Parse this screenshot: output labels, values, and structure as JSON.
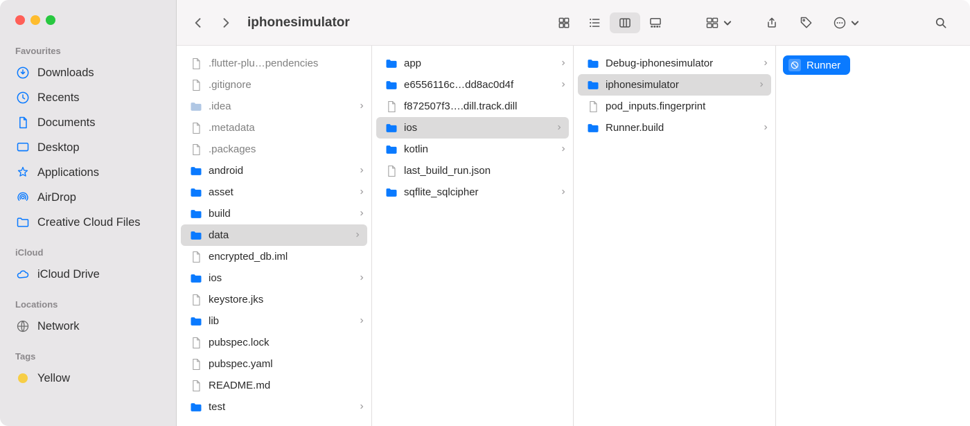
{
  "window_title": "iphonesimulator",
  "sidebar": {
    "favourites": {
      "heading": "Favourites",
      "items": [
        {
          "label": "Downloads",
          "icon": "download"
        },
        {
          "label": "Recents",
          "icon": "recents"
        },
        {
          "label": "Documents",
          "icon": "documents"
        },
        {
          "label": "Desktop",
          "icon": "desktop"
        },
        {
          "label": "Applications",
          "icon": "applications"
        },
        {
          "label": "AirDrop",
          "icon": "airdrop"
        },
        {
          "label": "Creative Cloud Files",
          "icon": "folder"
        }
      ]
    },
    "icloud": {
      "heading": "iCloud",
      "items": [
        {
          "label": "iCloud Drive",
          "icon": "cloud"
        }
      ]
    },
    "locations": {
      "heading": "Locations",
      "items": [
        {
          "label": "Network",
          "icon": "network"
        }
      ]
    },
    "tags": {
      "heading": "Tags",
      "items": [
        {
          "label": "Yellow",
          "color": "#f7ce46"
        }
      ]
    }
  },
  "columns": [
    {
      "selected_index": 8,
      "items": [
        {
          "label": ".flutter-plu…pendencies",
          "type": "file",
          "dim": true
        },
        {
          "label": ".gitignore",
          "type": "file",
          "dim": true
        },
        {
          "label": ".idea",
          "type": "folder",
          "dim": true,
          "expandable": true,
          "faded": true
        },
        {
          "label": ".metadata",
          "type": "file",
          "dim": true
        },
        {
          "label": ".packages",
          "type": "file",
          "dim": true
        },
        {
          "label": "android",
          "type": "folder",
          "expandable": true
        },
        {
          "label": "asset",
          "type": "folder",
          "expandable": true
        },
        {
          "label": "build",
          "type": "folder",
          "expandable": true
        },
        {
          "label": "data",
          "type": "folder",
          "expandable": true
        },
        {
          "label": "encrypted_db.iml",
          "type": "file",
          "icon": "iml"
        },
        {
          "label": "ios",
          "type": "folder",
          "expandable": true
        },
        {
          "label": "keystore.jks",
          "type": "file"
        },
        {
          "label": "lib",
          "type": "folder",
          "expandable": true
        },
        {
          "label": "pubspec.lock",
          "type": "file"
        },
        {
          "label": "pubspec.yaml",
          "type": "file",
          "icon": "yaml"
        },
        {
          "label": "README.md",
          "type": "file",
          "icon": "md"
        },
        {
          "label": "test",
          "type": "folder",
          "expandable": true
        }
      ]
    },
    {
      "selected_index": 3,
      "items": [
        {
          "label": "app",
          "type": "folder",
          "expandable": true
        },
        {
          "label": "e6556116c…dd8ac0d4f",
          "type": "folder",
          "expandable": true
        },
        {
          "label": "f872507f3….dill.track.dill",
          "type": "file"
        },
        {
          "label": "ios",
          "type": "folder",
          "expandable": true
        },
        {
          "label": "kotlin",
          "type": "folder",
          "expandable": true
        },
        {
          "label": "last_build_run.json",
          "type": "file",
          "icon": "json"
        },
        {
          "label": "sqflite_sqlcipher",
          "type": "folder",
          "expandable": true
        }
      ]
    },
    {
      "selected_index": 1,
      "items": [
        {
          "label": "Debug-iphonesimulator",
          "type": "folder",
          "expandable": true
        },
        {
          "label": "iphonesimulator",
          "type": "folder",
          "expandable": true
        },
        {
          "label": "pod_inputs.fingerprint",
          "type": "file"
        },
        {
          "label": "Runner.build",
          "type": "folder",
          "expandable": true
        }
      ]
    },
    {
      "selected_index": 0,
      "items": [
        {
          "label": "Runner",
          "type": "app"
        }
      ]
    }
  ]
}
